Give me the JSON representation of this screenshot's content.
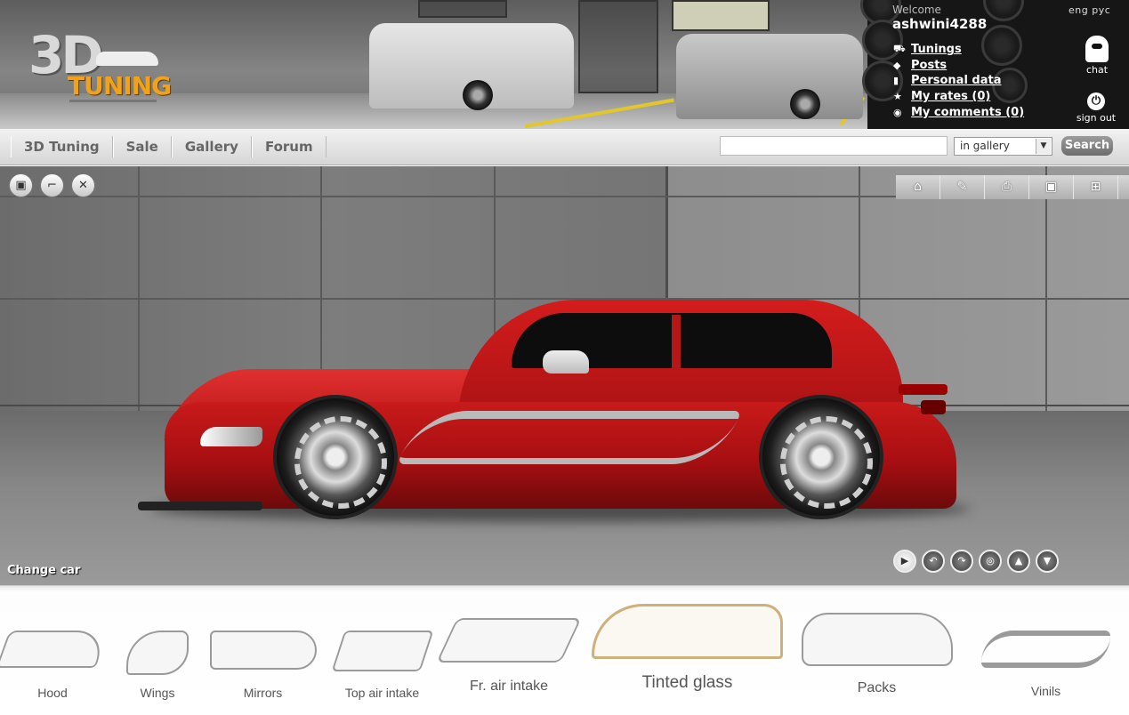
{
  "logo": {
    "big": "3D",
    "word": "TUNING"
  },
  "user": {
    "welcome": "Welcome",
    "username": "ashwini4288",
    "menu": [
      {
        "icon": "cart-icon",
        "label": "Tunings"
      },
      {
        "icon": "posts-icon",
        "label": "Posts"
      },
      {
        "icon": "document-icon",
        "label": "Personal data"
      },
      {
        "icon": "star-icon",
        "label": "My rates (0)"
      },
      {
        "icon": "comment-icon",
        "label": "My comments (0)"
      }
    ],
    "language": "eng рус",
    "chat_label": "chat",
    "signout_label": "sign out"
  },
  "nav": {
    "items": [
      "3D Tuning",
      "Sale",
      "Gallery",
      "Forum"
    ]
  },
  "search": {
    "value": "",
    "scope": "in gallery",
    "button": "Search"
  },
  "stage": {
    "tools": [
      "save-icon",
      "car-icon",
      "tools-icon"
    ],
    "top_nav": [
      "home-icon",
      "paint-icon",
      "printer-icon",
      "photo-icon",
      "sitemap-icon"
    ],
    "change_car": "Change car",
    "view_controls": [
      "play-icon",
      "rotate-left-icon",
      "rotate-right-icon",
      "wheel-view-icon",
      "upload-icon",
      "download-icon"
    ]
  },
  "parts": [
    "Hood",
    "Wings",
    "Mirrors",
    "Top air intake",
    "Fr. air intake",
    "Tinted glass",
    "Packs",
    "Vinils"
  ],
  "colors": {
    "accent_orange": "#f0a21a",
    "car_red": "#c81a1a"
  }
}
